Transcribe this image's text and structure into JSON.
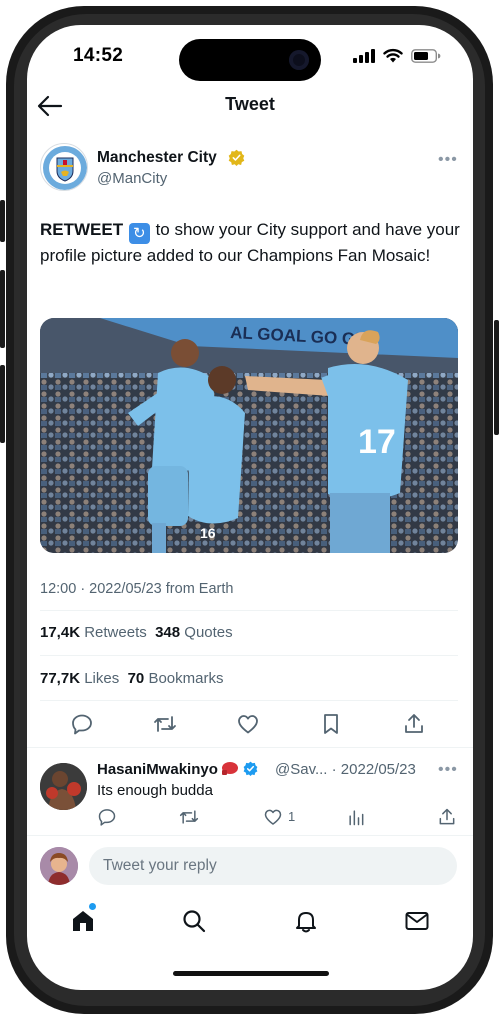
{
  "status_bar": {
    "time": "14:52"
  },
  "header": {
    "title": "Tweet"
  },
  "tweet": {
    "author_name": "Manchester City",
    "author_handle": "@ManCity",
    "text_strong": "RETWEET",
    "text_rest": " to show your City support and have your profile picture added to our Champions Fan Mosaic!",
    "media_banner_text": "AL GOAL GO GI",
    "shirt_number": "17",
    "meta": "12:00 · 2022/05/23 from Earth",
    "stats": {
      "retweets_count": "17,4K",
      "retweets_label": "Retweets",
      "quotes_count": "348",
      "quotes_label": "Quotes",
      "likes_count": "77,7K",
      "likes_label": "Likes",
      "bookmarks_count": "70",
      "bookmarks_label": "Bookmarks"
    }
  },
  "reply": {
    "name": "HasaniMwakinyo",
    "handle_date": "@Sav... · 2022/05/23",
    "text": "Its enough budda",
    "like_count": "1"
  },
  "compose": {
    "placeholder": "Tweet your reply"
  },
  "colors": {
    "accent": "#1d9bf0",
    "verified_gold": "#e2b719",
    "city_blue": "#6cabdd"
  },
  "icons": {
    "tweet_actions": [
      "reply-icon",
      "retweet-icon",
      "like-icon",
      "bookmark-icon",
      "share-icon"
    ],
    "reply_actions": [
      "reply-icon",
      "retweet-icon",
      "like-icon",
      "views-icon",
      "share-icon"
    ],
    "bottom_nav": [
      "home-icon",
      "search-icon",
      "notifications-icon",
      "messages-icon"
    ]
  }
}
